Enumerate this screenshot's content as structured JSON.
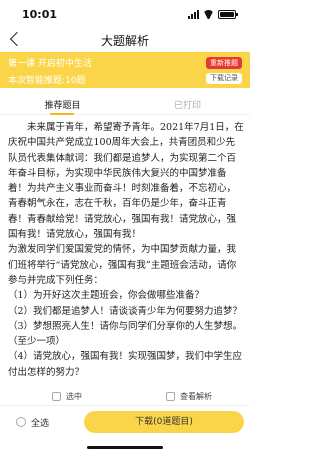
{
  "status_bar": {
    "time": "10:01"
  },
  "nav": {
    "title": "大题解析"
  },
  "banner": {
    "lesson": "第一课 开启初中生活",
    "sub": "本次智能推题:10题",
    "btn_reselect": "重新推题",
    "btn_download_record": "下载记录",
    "color": "#fbd549"
  },
  "tabs": [
    {
      "label": "推荐题目",
      "active": true
    },
    {
      "label": "已打印",
      "active": false
    }
  ],
  "passage": {
    "para1": "未来属于青年，希望寄予青年。2021年7月1日，在庆祝中国共产党成立100周年大会上，共青团员和少先队员代表集体献词：我们都是追梦人，为实现第二个百年奋斗目标，为实现中华民族伟大复兴的中国梦准备着！为共产主义事业而奋斗！时刻准备着，不忘初心，青春朝气永在，志在千秋，百年仍是少年，奋斗正青春！青春献给党！请党放心，强国有我！请党放心，强国有我！请党放心，强国有我！",
    "para2": "为激发同学们爱国爱党的情怀，为中国梦贡献力量，我们班将举行“请党放心，强国有我”主题班会活动，请你参与并完成下列任务：",
    "q1": "（1）为开好这次主题班会，你会做哪些准备？",
    "q2": "（2）我们都是追梦人！请谈谈青少年为何要努力追梦？",
    "q3": "（3）梦想照亮人生！请你与同学们分享你的人生梦想。（至少一项）",
    "q4": "（4）请党放心，强国有我！实现强国梦，我们中学生应付出怎样的努力？"
  },
  "options": {
    "select_label": "选中",
    "analysis_label": "查看解析"
  },
  "bottom": {
    "select_all": "全选",
    "download": "下载(0道题目)",
    "accent": "#fbd549"
  }
}
